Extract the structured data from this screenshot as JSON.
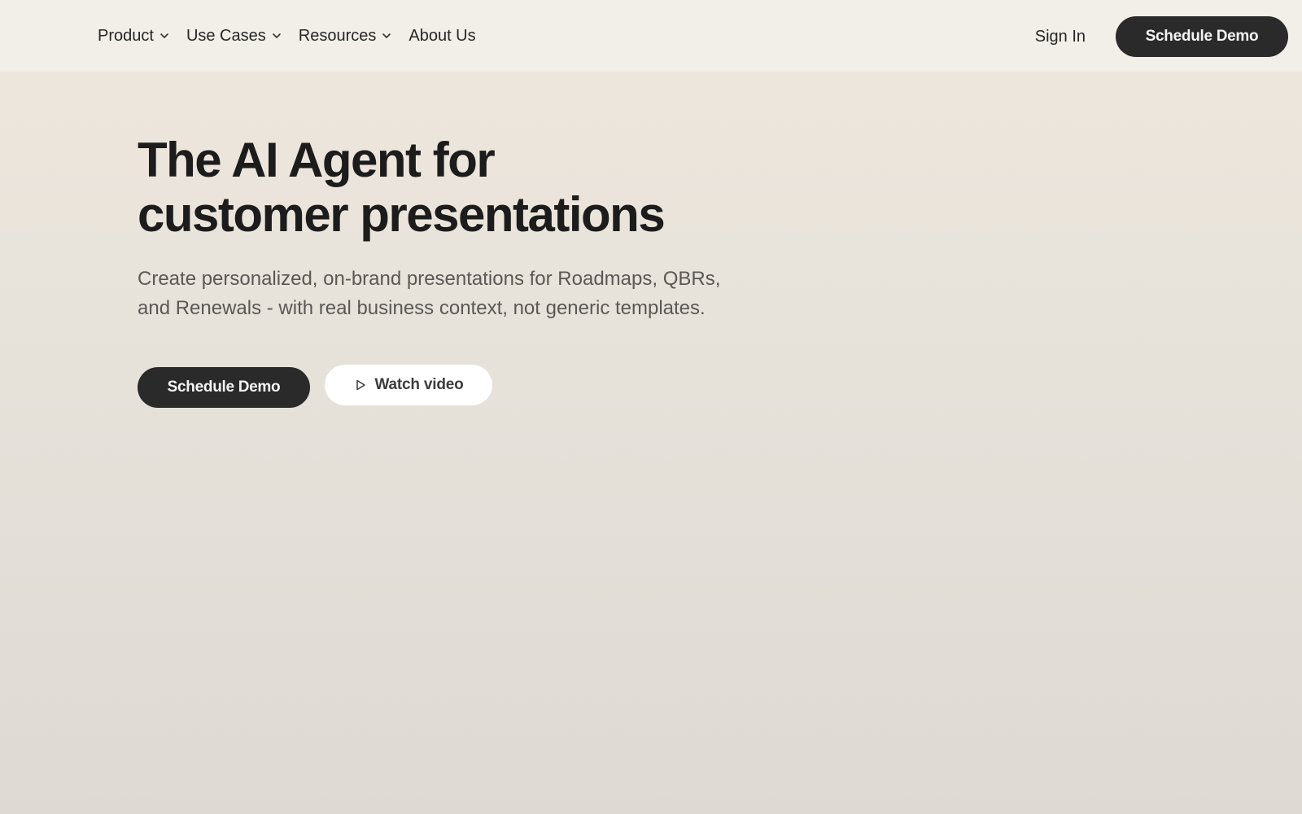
{
  "nav": {
    "items": [
      {
        "label": "Product",
        "has_dropdown": true
      },
      {
        "label": "Use Cases",
        "has_dropdown": true
      },
      {
        "label": "Resources",
        "has_dropdown": true
      },
      {
        "label": "About Us",
        "has_dropdown": false
      }
    ],
    "sign_in": "Sign In",
    "cta": "Schedule Demo"
  },
  "hero": {
    "title_line1": "The AI Agent for",
    "title_line2": "customer presentations",
    "subtitle_line1": "Create personalized, on-brand presentations for Roadmaps, QBRs,",
    "subtitle_line2": "and Renewals - with real business context, not generic templates.",
    "primary_cta": "Schedule Demo",
    "secondary_cta": "Watch video",
    "secondary_icon": "play-icon"
  },
  "colors": {
    "nav_bg": "#f2efe8",
    "dark_button": "#2a2a2a",
    "light_button": "#ffffff",
    "heading": "#1c1c1c",
    "subtext": "#5a5856"
  }
}
